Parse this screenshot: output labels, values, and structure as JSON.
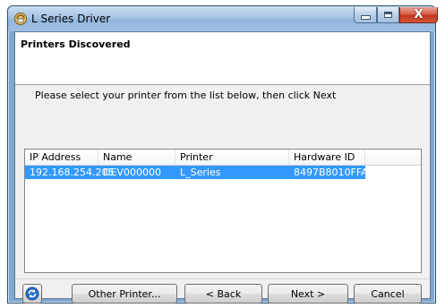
{
  "window": {
    "title": "L Series Driver",
    "close_glyph": "X"
  },
  "header": {
    "title": "Printers Discovered"
  },
  "instruction": "Please select your printer from the list below, then click Next",
  "table": {
    "columns": [
      "IP Address",
      "Name",
      "Printer",
      "Hardware ID"
    ],
    "rows": [
      [
        "192.168.254.205",
        "DEV000000",
        "L_Series",
        "8497B8010FFA"
      ]
    ],
    "selected_row": 0
  },
  "buttons": {
    "other_printer": "Other Printer...",
    "back": "< Back",
    "next": "Next >",
    "cancel": "Cancel"
  },
  "icons": {
    "app": "printer-driver-icon",
    "refresh": "refresh-icon"
  },
  "colors": {
    "selection": "#3399ff",
    "close_button": "#c3361c"
  }
}
